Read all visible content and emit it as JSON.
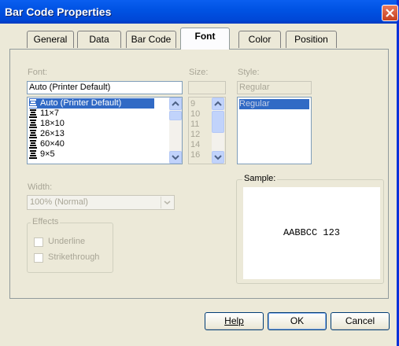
{
  "window": {
    "title": "Bar Code Properties"
  },
  "tabs": [
    {
      "label": "General"
    },
    {
      "label": "Data"
    },
    {
      "label": "Bar Code"
    },
    {
      "label": "Font"
    },
    {
      "label": "Color"
    },
    {
      "label": "Position"
    }
  ],
  "active_tab": "Font",
  "font": {
    "label": "Font:",
    "value": "Auto (Printer Default)",
    "items": [
      "Auto (Printer Default)",
      "11×7",
      "18×10",
      "26×13",
      "60×40",
      "9×5"
    ],
    "selected": "Auto (Printer Default)"
  },
  "size": {
    "label": "Size:",
    "value": "",
    "items": [
      "9",
      "10",
      "11",
      "12",
      "14",
      "16"
    ]
  },
  "style": {
    "label": "Style:",
    "value": "Regular",
    "items": [
      "Regular"
    ]
  },
  "width": {
    "label": "Width:",
    "value": "100% (Normal)"
  },
  "effects": {
    "label": "Effects",
    "underline": "Underline",
    "strikethrough": "Strikethrough"
  },
  "sample": {
    "label": "Sample:",
    "text": "AABBCC 123"
  },
  "buttons": {
    "help": "Help",
    "ok": "OK",
    "cancel": "Cancel"
  }
}
